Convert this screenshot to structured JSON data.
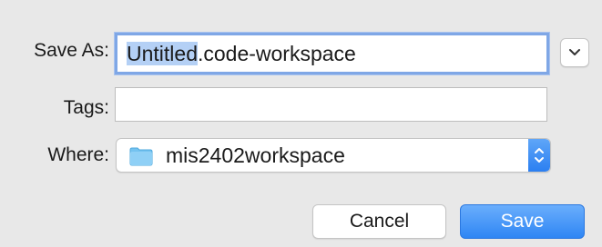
{
  "save_as": {
    "label": "Save As:",
    "value_selected": "Untitled",
    "value_rest": ".code-workspace",
    "expand_icon": "chevron-down-icon"
  },
  "tags": {
    "label": "Tags:",
    "value": ""
  },
  "where": {
    "label": "Where:",
    "folder_icon": "folder-icon",
    "value": "mis2402workspace",
    "arrows_icon": "up-down-arrows-icon"
  },
  "buttons": {
    "cancel": "Cancel",
    "save": "Save"
  },
  "colors": {
    "accent": "#2f86f4",
    "selection": "#b4d0f5",
    "focus_ring": "#7fa7e6",
    "folder": "#74c3f0"
  }
}
